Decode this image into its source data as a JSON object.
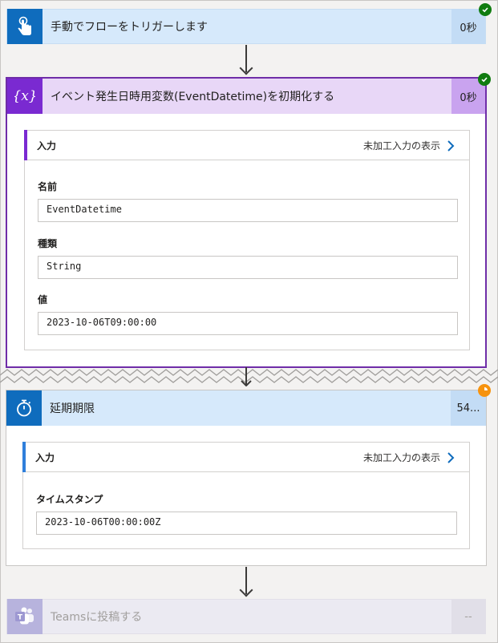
{
  "steps": {
    "trigger": {
      "title": "手動でフローをトリガーします",
      "duration": "0秒",
      "status": "succeeded",
      "icon": "touch-icon"
    },
    "init_variable": {
      "title": "イベント発生日時用変数(EventDatetime)を初期化する",
      "duration": "0秒",
      "status": "succeeded",
      "icon": "variable-icon",
      "inputs_section": {
        "title": "入力",
        "raw_link": "未加工入力の表示",
        "fields": [
          {
            "label": "名前",
            "value": "EventDatetime"
          },
          {
            "label": "種類",
            "value": "String"
          },
          {
            "label": "値",
            "value": "2023-10-06T09:00:00"
          }
        ]
      }
    },
    "delay_until": {
      "title": "延期期限",
      "duration": "54...",
      "status": "running",
      "icon": "timer-icon",
      "inputs_section": {
        "title": "入力",
        "raw_link": "未加工入力の表示",
        "fields": [
          {
            "label": "タイムスタンプ",
            "value": "2023-10-06T00:00:00Z"
          }
        ]
      }
    },
    "teams_post": {
      "title": "Teamsに投稿する",
      "duration": "--",
      "status": "not-run",
      "icon": "teams-icon"
    }
  },
  "colors": {
    "success": "#107c10",
    "running": "#f7930e",
    "variable_accent": "#7a2ad1",
    "primary_blue": "#0f6cbd"
  }
}
